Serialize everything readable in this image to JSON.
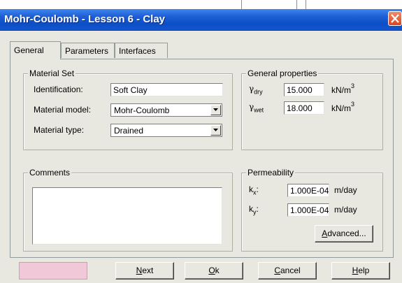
{
  "window": {
    "title": "Mohr-Coulomb - Lesson 6 - Clay"
  },
  "tabs": [
    "General",
    "Parameters",
    "Interfaces"
  ],
  "material_set": {
    "legend": "Material Set",
    "identification_label": "Identification:",
    "identification_value": "Soft Clay",
    "model_label": "Material model:",
    "model_value": "Mohr-Coulomb",
    "type_label": "Material type:",
    "type_value": "Drained"
  },
  "general_properties": {
    "legend": "General properties",
    "gamma_symbol": "γ",
    "dry_sub": "dry",
    "dry_value": "15.000",
    "wet_sub": "wet",
    "wet_value": "18.000",
    "unit": "kN/m",
    "unit_sup": "3"
  },
  "comments": {
    "legend": "Comments"
  },
  "permeability": {
    "legend": "Permeability",
    "k_symbol": "k",
    "kx_sub": "x",
    "ky_sub": "y",
    "colon": ":",
    "kx_value": "1.000E-04",
    "ky_value": "1.000E-04",
    "unit": "m/day",
    "advanced_button": {
      "first": "A",
      "rest": "dvanced..."
    }
  },
  "buttons": {
    "next": {
      "first": "N",
      "rest": "ext"
    },
    "ok": {
      "first": "O",
      "rest": "k"
    },
    "cancel": {
      "first": "C",
      "rest": "ancel"
    },
    "help": {
      "first": "H",
      "rest": "elp"
    }
  },
  "colors": {
    "titlebar": "#0b4ec5",
    "close_button": "#d9461f",
    "dialog_background": "#e9e8e0",
    "color_swatch": "#f0c8d8"
  },
  "icons": [
    "close-icon",
    "chevron-down-icon"
  ]
}
